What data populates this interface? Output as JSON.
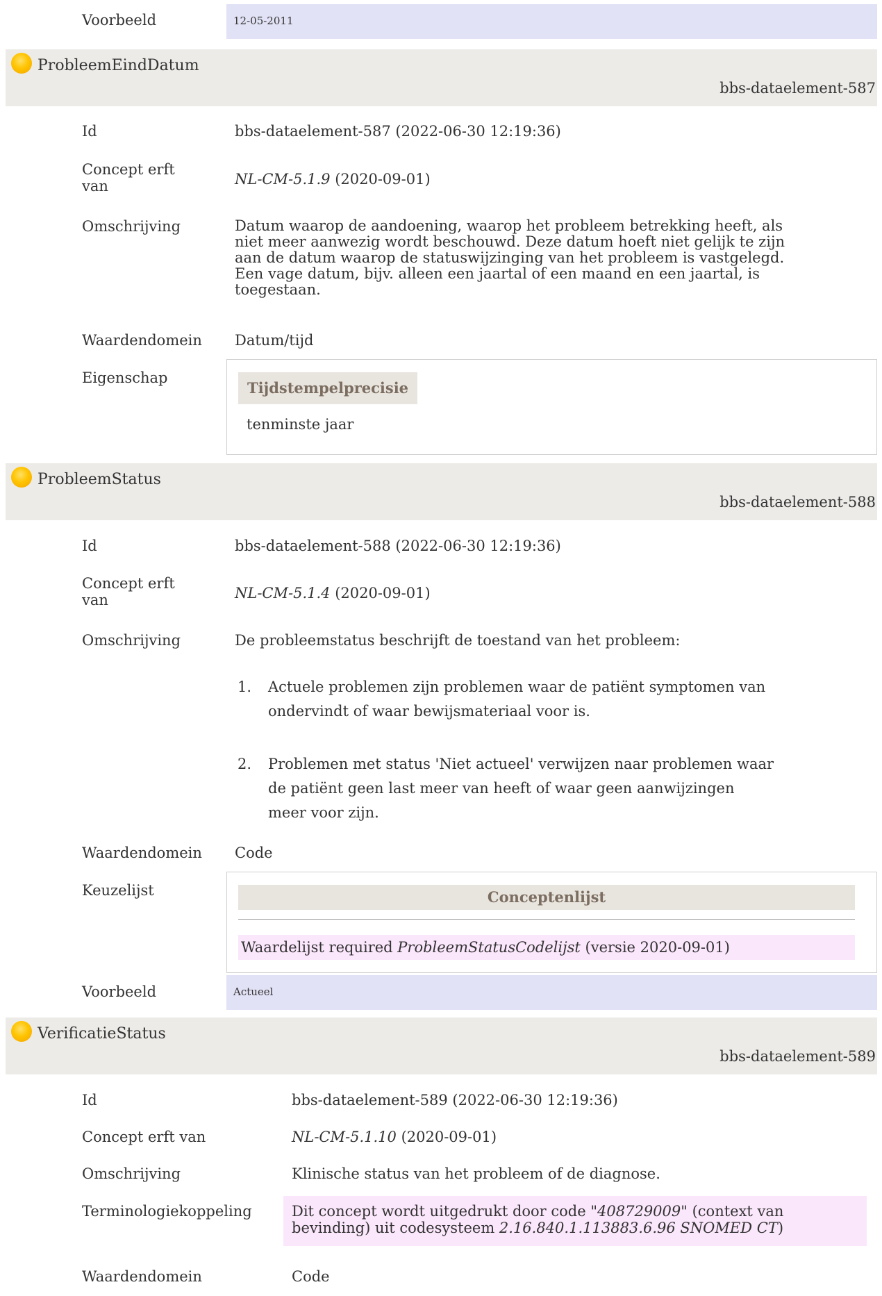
{
  "top": {
    "voorbeeld_label": "Voorbeeld",
    "voorbeeld_value": "12-05-2011"
  },
  "elements": [
    {
      "title": "ProbleemEindDatum",
      "header_id": "bbs-dataelement-587",
      "rows": {
        "id_label": "Id",
        "id_value": "bbs-dataelement-587 (2022-06-30 12:19:36)",
        "concept_label_1": "Concept erft",
        "concept_label_2": "van",
        "concept_ref": "NL-CM-5.1.9",
        "concept_date": " (2020-09-01)",
        "omschrijving_label": "Omschrijving",
        "omschrijving_lines": [
          "Datum waarop de aandoening, waarop het probleem betrekking heeft, als",
          "niet meer aanwezig wordt beschouwd. Deze datum hoeft niet gelijk te zijn",
          "aan de datum waarop de statuswijzinging van het probleem is vastgelegd.",
          "Een vage datum, bijv. alleen een jaartal of een maand en een jaartal, is",
          "toegestaan."
        ],
        "waardendomein_label": "Waardendomein",
        "waardendomein_value": "Datum/tijd",
        "eigenschap_label": "Eigenschap",
        "eigenschap_head": "Tijdstempelprecisie",
        "eigenschap_value": "tenminste jaar"
      }
    },
    {
      "title": "ProbleemStatus",
      "header_id": "bbs-dataelement-588",
      "rows": {
        "id_label": "Id",
        "id_value": "bbs-dataelement-588 (2022-06-30 12:19:36)",
        "concept_label_1": "Concept erft",
        "concept_label_2": "van",
        "concept_ref": "NL-CM-5.1.4",
        "concept_date": " (2020-09-01)",
        "omschrijving_label": "Omschrijving",
        "omschrijving_intro": "De probleemstatus beschrijft de toestand van het probleem:",
        "list": [
          {
            "num": "1.",
            "lines": [
              "Actuele problemen zijn problemen waar de patiënt symptomen van",
              "ondervindt of waar bewijsmateriaal voor is."
            ]
          },
          {
            "num": "2.",
            "lines": [
              "Problemen met status 'Niet actueel' verwijzen naar problemen waar",
              "de patiënt geen last meer van heeft of waar geen aanwijzingen",
              "meer voor zijn."
            ]
          }
        ],
        "waardendomein_label": "Waardendomein",
        "waardendomein_value": "Code",
        "keuzelijst_label": "Keuzelijst",
        "conceptenlijst_head": "Conceptenlijst",
        "waardelijst_prefix": "Waardelijst required ",
        "waardelijst_name": "ProbleemStatusCodelijst",
        "waardelijst_suffix": " (versie 2020-09-01)",
        "voorbeeld_label": "Voorbeeld",
        "voorbeeld_value": "Actueel"
      }
    },
    {
      "title": "VerificatieStatus",
      "header_id": "bbs-dataelement-589",
      "rows": {
        "id_label": "Id",
        "id_value": "bbs-dataelement-589 (2022-06-30 12:19:36)",
        "concept_label": "Concept erft van",
        "concept_ref": "NL-CM-5.1.10",
        "concept_date": " (2020-09-01)",
        "omschrijving_label": "Omschrijving",
        "omschrijving_value": "Klinische status van het probleem of de diagnose.",
        "terminologie_label": "Terminologiekoppeling",
        "term_line1_a": "Dit concept wordt uitgedrukt door code \"",
        "term_code": "408729009",
        "term_line1_b": "\" (context van",
        "term_line2_a": "bevinding) uit codesysteem ",
        "term_system": "2.16.840.1.113883.6.96 SNOMED CT",
        "term_line2_b": ")",
        "waardendomein_label": "Waardendomein",
        "waardendomein_value": "Code"
      }
    }
  ]
}
